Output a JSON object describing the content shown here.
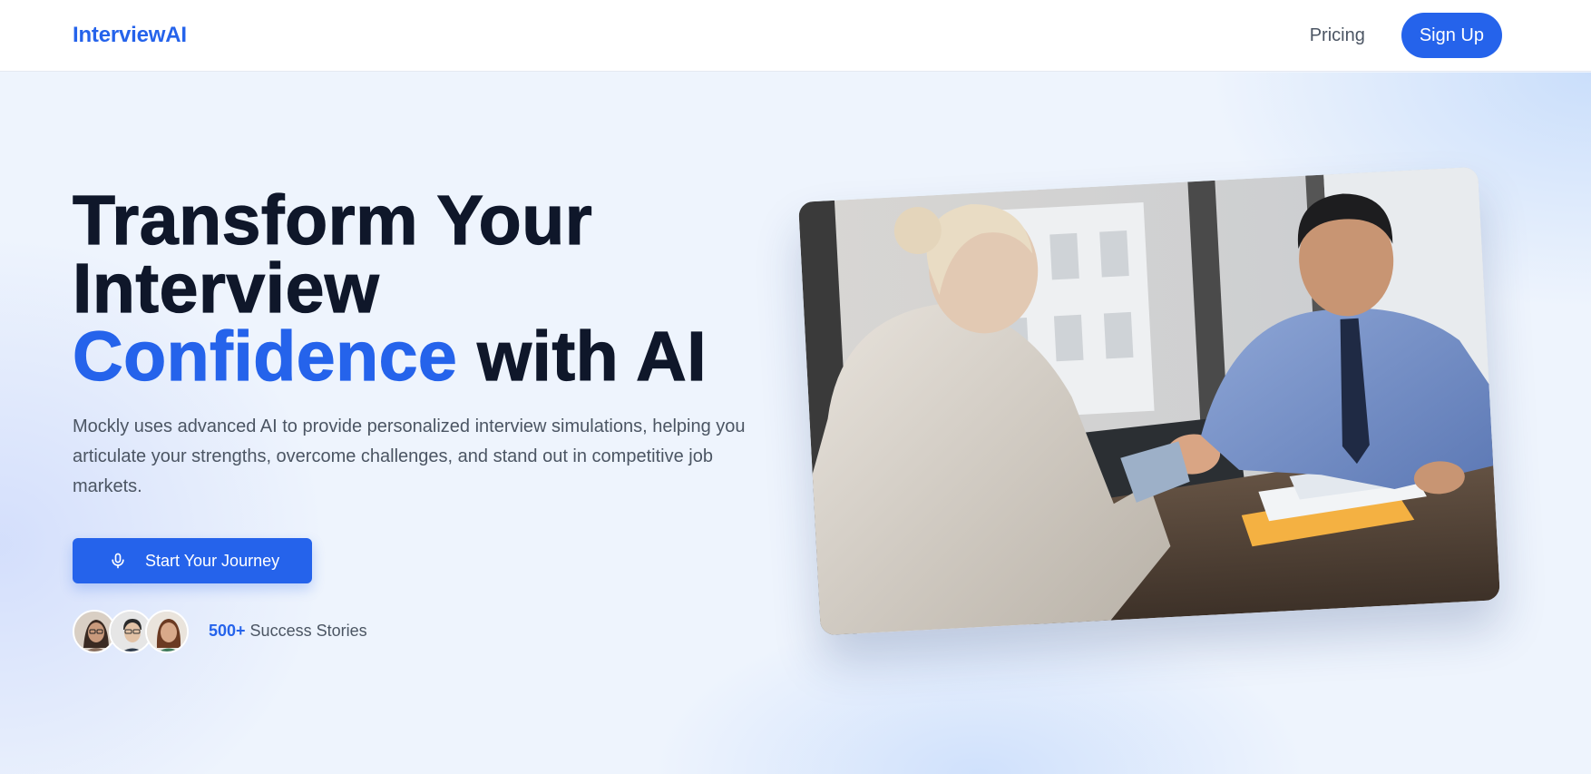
{
  "navbar": {
    "brand": "InterviewAI",
    "pricing_label": "Pricing",
    "signup_label": "Sign Up"
  },
  "hero": {
    "headline_line1": "Transform Your",
    "headline_line2": "Interview",
    "headline_accent": "Confidence",
    "headline_rest": " with AI",
    "subtitle": "Mockly uses advanced AI to provide personalized interview simulations, helping you articulate your strengths, overcome challenges, and stand out in competitive job markets.",
    "cta_label": "Start Your Journey",
    "cta_icon": "microphone-icon",
    "stories_count": "500+",
    "stories_label": " Success Stories"
  },
  "colors": {
    "brand_blue": "#2563eb",
    "heading_dark": "#0f172a",
    "body_gray": "#4b5563",
    "background": "#eef4fd"
  }
}
